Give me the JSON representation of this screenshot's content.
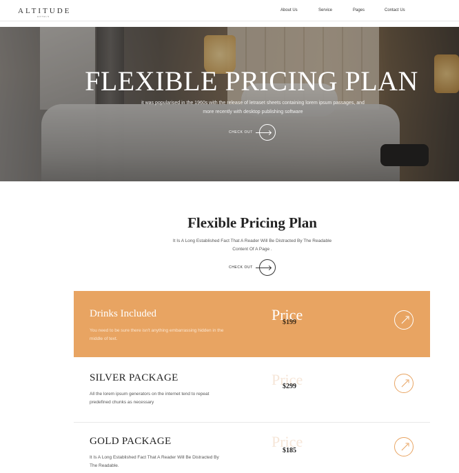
{
  "nav": {
    "logo": "ALTITUDE",
    "logo_sub": "HOTELS",
    "links": [
      "About Us",
      "Service",
      "Pages",
      "Contact Us"
    ]
  },
  "hero": {
    "title": "FLEXIBLE PRICING PLAN",
    "text": "it was popularised in the 1960s with the release of letraset sheets containing lorem ipsum passages, and more recently with desktop publishing software",
    "cta": "CHECK OUT"
  },
  "section": {
    "title": "Flexible Pricing Plan",
    "subtitle": "It Is A Long Established Fact That A Reader Will Be Distracted By The Readable Content Of A Page .",
    "cta": "CHECK OUT"
  },
  "packages": [
    {
      "title": "Drinks Included",
      "desc": "You need to be sure there isn't anything embarrassing hidden in the middle of text.",
      "price_label": "Price",
      "price": "$199"
    },
    {
      "title": "SILVER PACKAGE",
      "desc": "All the lorem ipsum generators on the internet tend to repeat predefined chunks as necessary",
      "price_label": "Price",
      "price": "$299"
    },
    {
      "title": "GOLD PACKAGE",
      "desc": "It Is A Long Established Fact That A Reader Will Be Distracted By The Readable.",
      "price_label": "Price",
      "price": "$185"
    }
  ],
  "colors": {
    "accent": "#e8a462",
    "text": "#222222"
  },
  "icons": {
    "cta": "arrow-right-icon",
    "package": "arrow-up-right-icon"
  }
}
